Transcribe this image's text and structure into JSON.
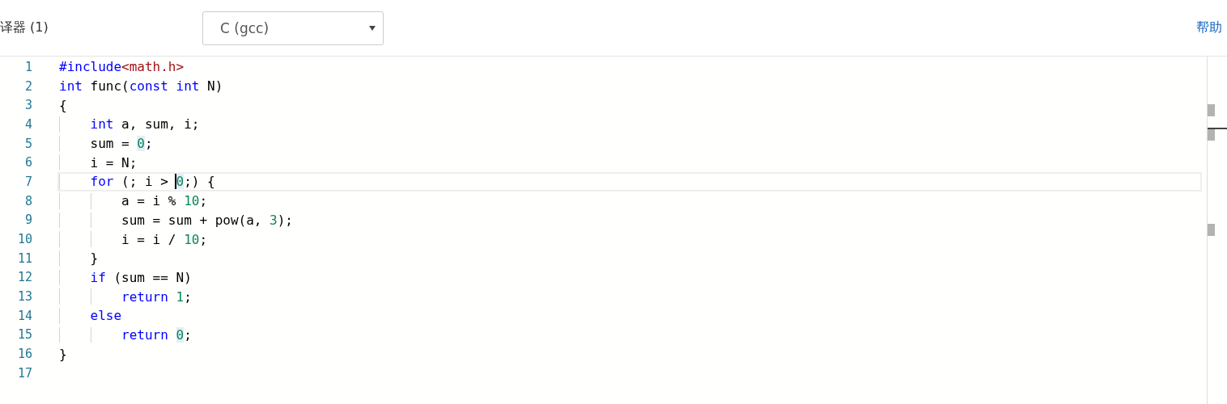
{
  "toolbar": {
    "label": "译器 (1)",
    "compiler_select": {
      "value": "C (gcc)"
    },
    "help_link": "帮助"
  },
  "editor": {
    "lines": [
      {
        "number": "1",
        "current": false,
        "tokens": [
          {
            "kind": "keyword",
            "text": "#include"
          },
          {
            "kind": "string",
            "text": "<math.h>"
          }
        ]
      },
      {
        "number": "2",
        "current": false,
        "tokens": [
          {
            "kind": "keyword",
            "text": "int"
          },
          {
            "kind": "plain",
            "text": " func("
          },
          {
            "kind": "keyword",
            "text": "const int"
          },
          {
            "kind": "plain",
            "text": " N)"
          }
        ]
      },
      {
        "number": "3",
        "current": false,
        "tokens": [
          {
            "kind": "plain",
            "text": "{"
          }
        ]
      },
      {
        "number": "4",
        "current": false,
        "tokens": [
          {
            "kind": "keyword",
            "text": "    int"
          },
          {
            "kind": "plain",
            "text": " a, sum, i;"
          }
        ]
      },
      {
        "number": "5",
        "current": false,
        "tokens": [
          {
            "kind": "plain",
            "text": "    sum = "
          },
          {
            "kind": "number",
            "text": "0",
            "highlighted": true
          },
          {
            "kind": "plain",
            "text": ";"
          }
        ]
      },
      {
        "number": "6",
        "current": false,
        "tokens": [
          {
            "kind": "plain",
            "text": "    i = N;"
          }
        ]
      },
      {
        "number": "7",
        "current": true,
        "tokens": [
          {
            "kind": "keyword",
            "text": "    for"
          },
          {
            "kind": "plain",
            "text": " (; i > "
          },
          {
            "kind": "number",
            "text": "0",
            "highlighted": true,
            "cursor": true
          },
          {
            "kind": "plain",
            "text": ";) {"
          }
        ]
      },
      {
        "number": "8",
        "current": false,
        "tokens": [
          {
            "kind": "plain",
            "text": "        a = i % "
          },
          {
            "kind": "number",
            "text": "10"
          },
          {
            "kind": "plain",
            "text": ";"
          }
        ]
      },
      {
        "number": "9",
        "current": false,
        "tokens": [
          {
            "kind": "plain",
            "text": "        sum = sum + pow(a, "
          },
          {
            "kind": "number",
            "text": "3"
          },
          {
            "kind": "plain",
            "text": ");"
          }
        ]
      },
      {
        "number": "10",
        "current": false,
        "tokens": [
          {
            "kind": "plain",
            "text": "        i = i / "
          },
          {
            "kind": "number",
            "text": "10"
          },
          {
            "kind": "plain",
            "text": ";"
          }
        ]
      },
      {
        "number": "11",
        "current": false,
        "tokens": [
          {
            "kind": "plain",
            "text": "    }"
          }
        ]
      },
      {
        "number": "12",
        "current": false,
        "tokens": [
          {
            "kind": "keyword",
            "text": "    if"
          },
          {
            "kind": "plain",
            "text": " (sum == N)"
          }
        ]
      },
      {
        "number": "13",
        "current": false,
        "tokens": [
          {
            "kind": "keyword",
            "text": "        return "
          },
          {
            "kind": "number",
            "text": "1"
          },
          {
            "kind": "plain",
            "text": ";"
          }
        ]
      },
      {
        "number": "14",
        "current": false,
        "tokens": [
          {
            "kind": "keyword",
            "text": "    else"
          }
        ]
      },
      {
        "number": "15",
        "current": false,
        "tokens": [
          {
            "kind": "keyword",
            "text": "        return "
          },
          {
            "kind": "number",
            "text": "0",
            "highlighted": true
          },
          {
            "kind": "plain",
            "text": ";"
          }
        ]
      },
      {
        "number": "16",
        "current": false,
        "tokens": [
          {
            "kind": "plain",
            "text": "}"
          }
        ]
      },
      {
        "number": "17",
        "current": false
      }
    ]
  }
}
